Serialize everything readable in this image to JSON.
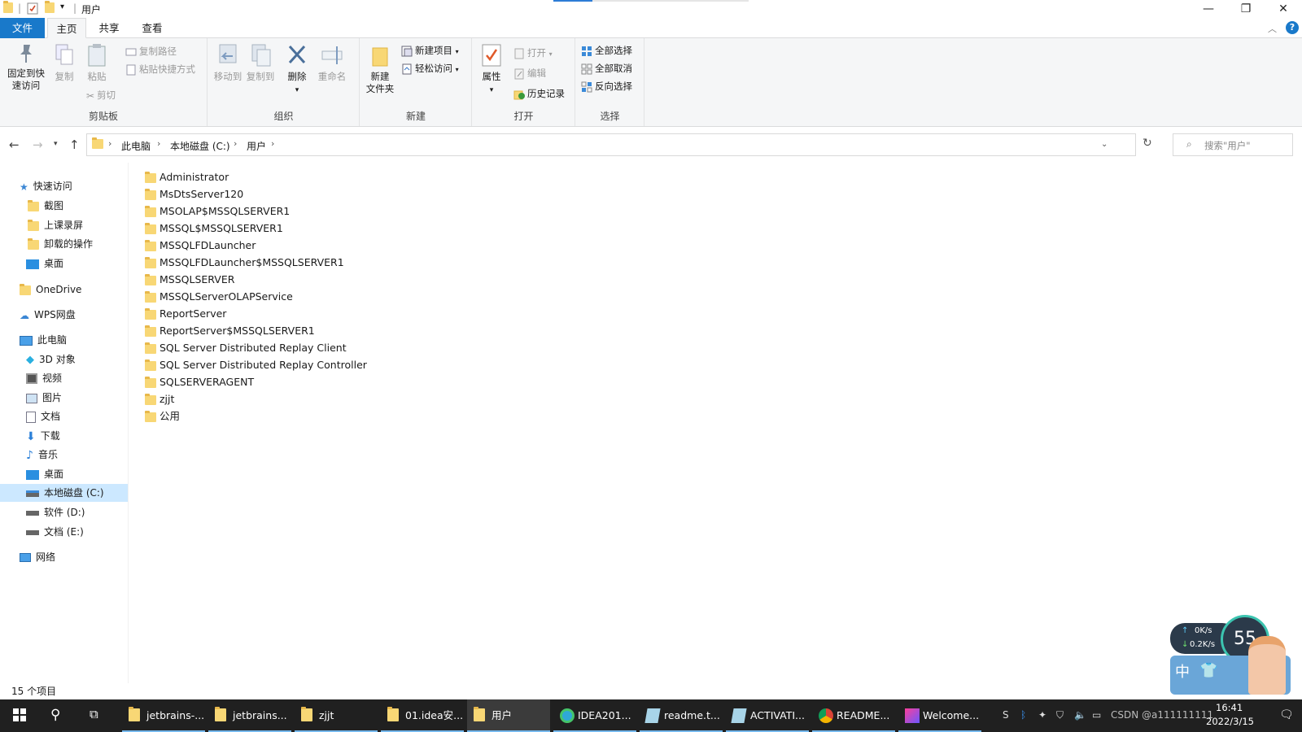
{
  "window": {
    "title": "用户",
    "controls": {
      "minimize": "—",
      "maximize": "❐",
      "close": "✕"
    }
  },
  "ribbon_tabs": [
    "文件",
    "主页",
    "共享",
    "查看"
  ],
  "ribbon": {
    "clipboard": {
      "label": "剪贴板",
      "pin_line1": "固定到快",
      "pin_line2": "速访问",
      "copy": "复制",
      "paste": "粘贴",
      "copy_path": "复制路径",
      "paste_shortcut": "粘贴快捷方式",
      "cut": "剪切"
    },
    "organize": {
      "label": "组织",
      "move_to": "移动到",
      "copy_to": "复制到",
      "delete": "删除",
      "rename": "重命名"
    },
    "new": {
      "label": "新建",
      "new_folder_line1": "新建",
      "new_folder_line2": "文件夹",
      "new_item": "新建项目",
      "easy_access": "轻松访问"
    },
    "open": {
      "label": "打开",
      "properties": "属性",
      "open": "打开",
      "edit": "编辑",
      "history": "历史记录"
    },
    "select": {
      "label": "选择",
      "select_all": "全部选择",
      "select_none": "全部取消",
      "invert": "反向选择"
    }
  },
  "address": {
    "crumbs": [
      "此电脑",
      "本地磁盘 (C:)",
      "用户"
    ],
    "search_placeholder": "搜索\"用户\""
  },
  "nav": {
    "quick_access": "快速访问",
    "quick_items": [
      "截图",
      "上课录屏",
      "卸载的操作",
      "桌面"
    ],
    "onedrive": "OneDrive",
    "wps": "WPS网盘",
    "this_pc": "此电脑",
    "pc_items": [
      "3D 对象",
      "视频",
      "图片",
      "文档",
      "下载",
      "音乐",
      "桌面",
      "本地磁盘 (C:)",
      "软件 (D:)",
      "文档 (E:)"
    ],
    "network": "网络"
  },
  "files": [
    "Administrator",
    "MsDtsServer120",
    "MSOLAP$MSSQLSERVER1",
    "MSSQL$MSSQLSERVER1",
    "MSSQLFDLauncher",
    "MSSQLFDLauncher$MSSQLSERVER1",
    "MSSQLSERVER",
    "MSSQLServerOLAPService",
    "ReportServer",
    "ReportServer$MSSQLSERVER1",
    "SQL Server Distributed Replay Client",
    "SQL Server Distributed Replay Controller",
    "SQLSERVERAGENT",
    "zjjt",
    "公用"
  ],
  "status": "15 个项目",
  "taskbar": {
    "items": [
      "jetbrains-...",
      "jetbrains...",
      "zjjt",
      "01.idea安...",
      "用户",
      "IDEA201...",
      "readme.t...",
      "ACTIVATI...",
      "README...",
      "Welcome..."
    ],
    "time": "16:41",
    "date": "2022/3/15",
    "watermark": "CSDN @a111111111"
  },
  "widget": {
    "up": "0K/s",
    "down": "0.2K/s",
    "percent": "55",
    "ime": "中"
  }
}
